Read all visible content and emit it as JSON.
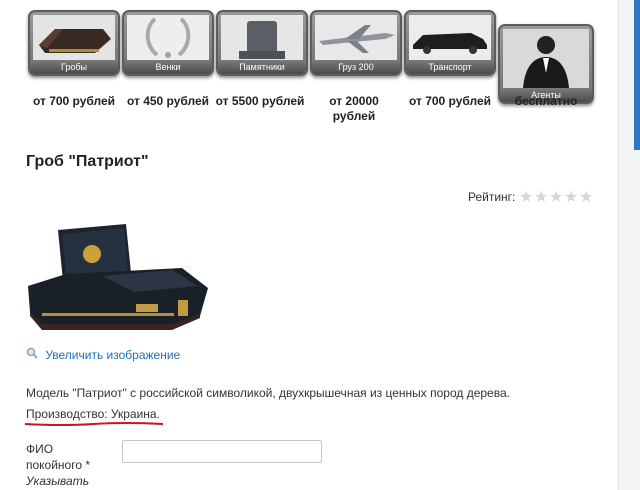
{
  "categories": [
    {
      "label": "Гробы",
      "price": "от 700 рублей",
      "icon": "coffin-icon"
    },
    {
      "label": "Венки",
      "price": "от 450 рублей",
      "icon": "wreath-icon"
    },
    {
      "label": "Памятники",
      "price": "от 5500 рублей",
      "icon": "monument-icon"
    },
    {
      "label": "Груз 200",
      "price": "от 20000 рублей",
      "icon": "airplane-icon"
    },
    {
      "label": "Транспорт",
      "price": "от 700 рублей",
      "icon": "hearse-icon"
    },
    {
      "label": "Агенты",
      "price": "бесплатно",
      "icon": "agent-icon"
    }
  ],
  "product": {
    "title": "Гроб \"Патриот\"",
    "rating_label": "Рейтинг:",
    "rating_value": 0,
    "rating_max": 5,
    "enlarge_link": "Увеличить изображение",
    "description": "Модель \"Патриот\" с российской символикой, двухкрышечная из ценных пород дерева.",
    "origin": "Производство: Украина."
  },
  "form": {
    "fio_label_line1": "ФИО",
    "fio_label_line2": "покойного *",
    "fio_hint": "Указывать",
    "fio_value": ""
  },
  "colors": {
    "link": "#1f6fb5",
    "underline": "#d0121b",
    "scrollbar": "#2f78c6"
  }
}
